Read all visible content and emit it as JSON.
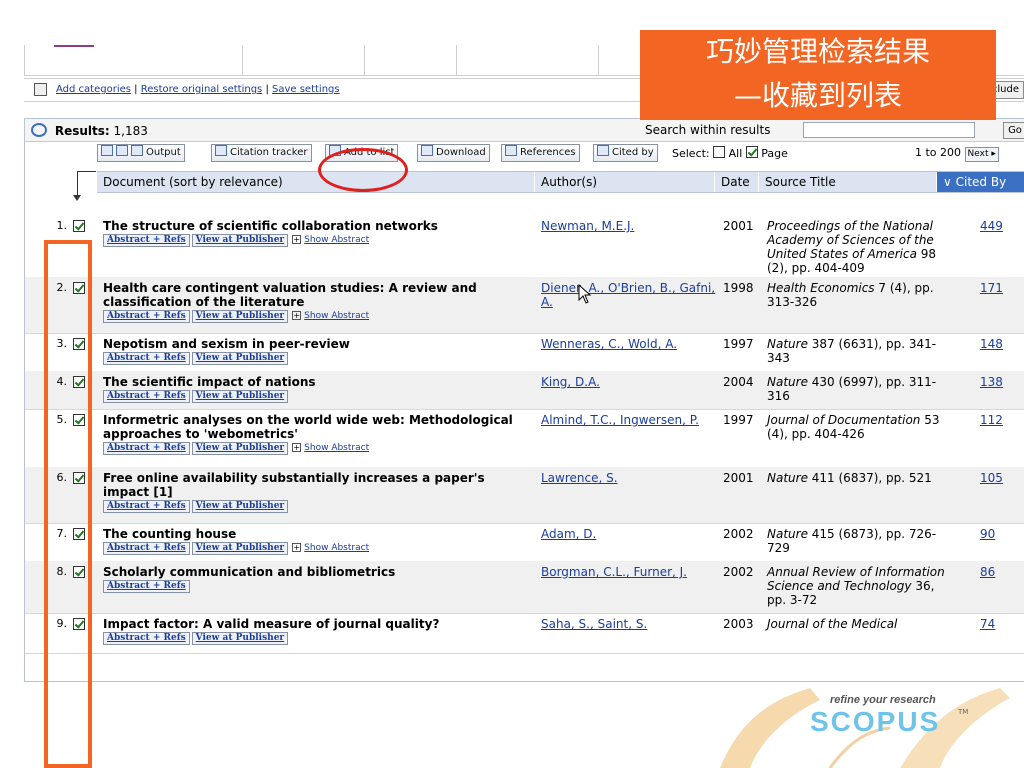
{
  "settings_bar": {
    "links": [
      "Add categories",
      "Restore original settings",
      "Save settings"
    ],
    "include_label": "clude"
  },
  "annotation": {
    "line1": "巧妙管理检索结果",
    "line2": "—收藏到列表"
  },
  "results": {
    "label": "Results:",
    "count": "1,183",
    "search_label": "Search within results",
    "search_value": "",
    "go_label": "Go"
  },
  "toolbar": {
    "output": "Output",
    "citation_tracker": "Citation tracker",
    "add_to_list": "Add to list",
    "download": "Download",
    "references": "References",
    "cited_by": "Cited by",
    "select_label": "Select:",
    "all_label": "All",
    "page_label": "Page",
    "range": "1 to 200",
    "next_label": "Next"
  },
  "columns": {
    "document": "Document (sort by relevance)",
    "authors": "Author(s)",
    "date": "Date",
    "source": "Source Title",
    "cited": "Cited By"
  },
  "link_labels": {
    "abstract_refs": "Abstract + Refs",
    "publisher": "View at Publisher",
    "show_abstract": "Show Abstract"
  },
  "rows": [
    {
      "num": "1.",
      "checked": true,
      "title": "The structure of scientific collaboration networks",
      "authors": "Newman, M.E.J.",
      "year": "2001",
      "source_italic": "Proceedings of the National Academy of Sciences of the United States of America",
      "source_rest": " 98 (2), pp. 404-409",
      "cited": "449"
    },
    {
      "num": "2.",
      "checked": true,
      "title": "Health care contingent valuation studies: A review and classification of the literature",
      "authors": "Diener, A., O'Brien, B., Gafni, A.",
      "year": "1998",
      "source_italic": "Health Economics",
      "source_rest": " 7 (4), pp. 313-326",
      "cited": "171"
    },
    {
      "num": "3.",
      "checked": true,
      "title": "Nepotism and sexism in peer-review",
      "authors": "Wenneras, C., Wold, A.",
      "year": "1997",
      "source_italic": "Nature",
      "source_rest": " 387 (6631), pp. 341-343",
      "cited": "148"
    },
    {
      "num": "4.",
      "checked": true,
      "title": "The scientific impact of nations",
      "authors": "King, D.A.",
      "year": "2004",
      "source_italic": "Nature",
      "source_rest": " 430 (6997), pp. 311-316",
      "cited": "138"
    },
    {
      "num": "5.",
      "checked": true,
      "title": "Informetric analyses on the world wide web: Methodological approaches to 'webometrics'",
      "authors": "Almind, T.C., Ingwersen, P.",
      "year": "1997",
      "source_italic": "Journal of Documentation",
      "source_rest": " 53 (4), pp. 404-426",
      "cited": "112"
    },
    {
      "num": "6.",
      "checked": true,
      "title": "Free online availability substantially increases a paper's impact [1]",
      "authors": "Lawrence, S.",
      "year": "2001",
      "source_italic": "Nature",
      "source_rest": " 411 (6837), pp. 521",
      "cited": "105"
    },
    {
      "num": "7.",
      "checked": true,
      "title": "The counting house",
      "authors": "Adam, D.",
      "year": "2002",
      "source_italic": "Nature",
      "source_rest": " 415 (6873), pp. 726-729",
      "cited": "90"
    },
    {
      "num": "8.",
      "checked": true,
      "title": "Scholarly communication and bibliometrics",
      "authors": "Borgman, C.L., Furner, J.",
      "year": "2002",
      "source_italic": "Annual Review of Information Science and Technology",
      "source_rest": " 36, pp. 3-72",
      "cited": "86"
    },
    {
      "num": "9.",
      "checked": true,
      "title": "Impact factor: A valid measure of journal quality?",
      "authors": "Saha, S., Saint, S.",
      "year": "2003",
      "source_italic": "Journal of the Medical",
      "source_rest": "",
      "cited": "74"
    }
  ],
  "logo": {
    "tagline": "refine your research",
    "word": "SCOPUS",
    "tm": "TM"
  }
}
